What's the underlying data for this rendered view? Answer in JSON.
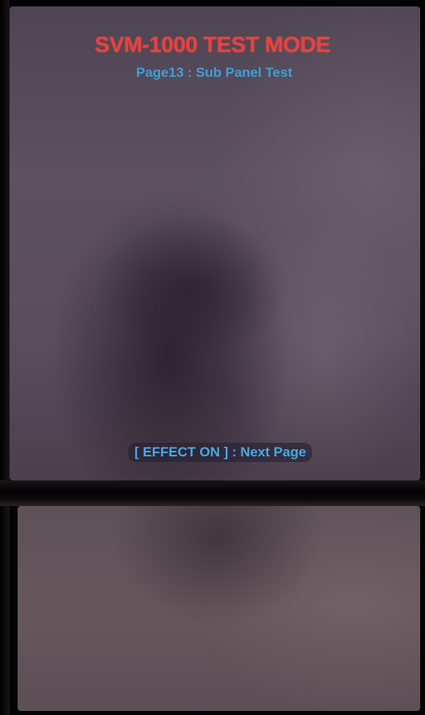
{
  "screen": {
    "title": "SVM-1000 TEST MODE",
    "page_label": "Page13 : Sub Panel Test",
    "nav_hint": "[ EFFECT ON ] : Next Page"
  },
  "colors": {
    "title": "#e8423f",
    "subtitle": "#3f9fd6",
    "hint": "#49a9e2",
    "panel": "#5a4e5d",
    "bezel": "#050405"
  }
}
